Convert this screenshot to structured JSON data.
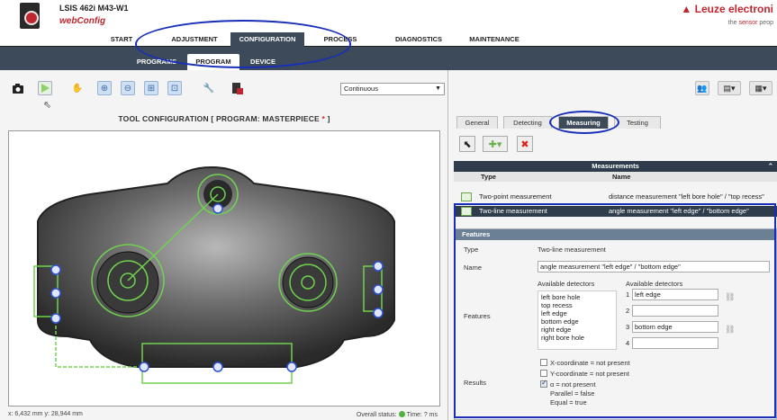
{
  "header": {
    "title": "LSIS 462i M43-W1",
    "subtitle": "webConfig",
    "brand": "▲ Leuze electroni",
    "tagline_prefix": "the ",
    "tagline_hl": "sensor",
    "tagline_suffix": " peop"
  },
  "mainnav": {
    "tabs": [
      {
        "label": "START"
      },
      {
        "label": "ADJUSTMENT"
      },
      {
        "label": "CONFIGURATION"
      },
      {
        "label": "PROCESS"
      },
      {
        "label": "DIAGNOSTICS"
      },
      {
        "label": "MAINTENANCE"
      }
    ],
    "active": "CONFIGURATION"
  },
  "subnav": {
    "tabs": [
      {
        "label": "PROGRAMS"
      },
      {
        "label": "PROGRAM"
      },
      {
        "label": "DEVICE"
      }
    ],
    "active": "PROGRAM"
  },
  "toolbar": {
    "mode": "Continuous",
    "icons": [
      "camera-icon",
      "play-icon",
      "hand-icon",
      "zoom-in-icon",
      "zoom-out-icon",
      "zoom-fit-icon",
      "zoom-area-icon",
      "wrench-icon",
      "save-icon"
    ]
  },
  "tool_title": {
    "text": "TOOL CONFIGURATION   [ PROGRAM: MASTERPIECE ",
    "star": "*",
    "suffix": " ]"
  },
  "status": {
    "coords": "x: 6,432 mm y: 28,944 mm",
    "overall_label": "Overall status:",
    "time": "Time: ? ms"
  },
  "right_tabs": [
    {
      "label": "General"
    },
    {
      "label": "Detecting"
    },
    {
      "label": "Measuring"
    },
    {
      "label": "Testing"
    }
  ],
  "measurements": {
    "header": "Measurements",
    "col_type": "Type",
    "col_name": "Name",
    "rows": [
      {
        "type": "Two-point measurement",
        "name": "distance measurement \"left bore hole\" / \"top recess\""
      },
      {
        "type": "Two-line measurement",
        "name": "angle measurement \"left edge\" / \"bottom edge\""
      }
    ]
  },
  "features": {
    "header": "Features",
    "type_label": "Type",
    "type_value": "Two-line measurement",
    "name_label": "Name",
    "name_value": "angle measurement \"left edge\" / \"bottom edge\"",
    "avail_label_1": "Available detectors",
    "avail_label_2": "Available detectors",
    "features_label": "Features",
    "detectors": [
      "left bore hole",
      "top recess",
      "left edge",
      "bottom edge",
      "right edge",
      "right bore hole"
    ],
    "slots": [
      {
        "num": "1",
        "value": "left edge"
      },
      {
        "num": "2",
        "value": ""
      },
      {
        "num": "3",
        "value": "bottom edge"
      },
      {
        "num": "4",
        "value": ""
      }
    ],
    "results_label": "Results",
    "results": {
      "x": "X-coordinate = not present",
      "y": "Y-coordinate = not present",
      "alpha": "α = not present",
      "parallel": "Parallel = false",
      "equal": "Equal = true"
    }
  }
}
